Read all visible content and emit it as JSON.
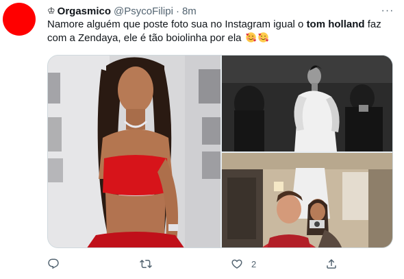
{
  "author": {
    "badge_icon": "crown-icon",
    "name": "Orgasmico",
    "handle": "@PsycoFilipi",
    "separator": "·",
    "time": "8m",
    "avatar_color": "#ff0000"
  },
  "tweet": {
    "text_before": "Namore alguém que poste foto sua no Instagram igual o ",
    "text_bold": "tom holland",
    "text_after": " faz com a Zendaya, ele é tão boiolinha por ela",
    "emojis": [
      "smiling-face-with-hearts-emoji",
      "smiling-face-with-hearts-emoji"
    ]
  },
  "media": {
    "images": [
      {
        "icon": "photo-red-dress"
      },
      {
        "icon": "photo-black-and-white"
      },
      {
        "icon": "photo-mirror-selfie"
      }
    ]
  },
  "actions": {
    "reply": {
      "icon": "reply-icon",
      "count": ""
    },
    "retweet": {
      "icon": "retweet-icon",
      "count": ""
    },
    "like": {
      "icon": "heart-icon",
      "count": "2"
    },
    "share": {
      "icon": "share-icon",
      "count": ""
    }
  },
  "colors": {
    "text": "#0f1419",
    "secondary": "#536471",
    "border": "#cfd9de"
  }
}
